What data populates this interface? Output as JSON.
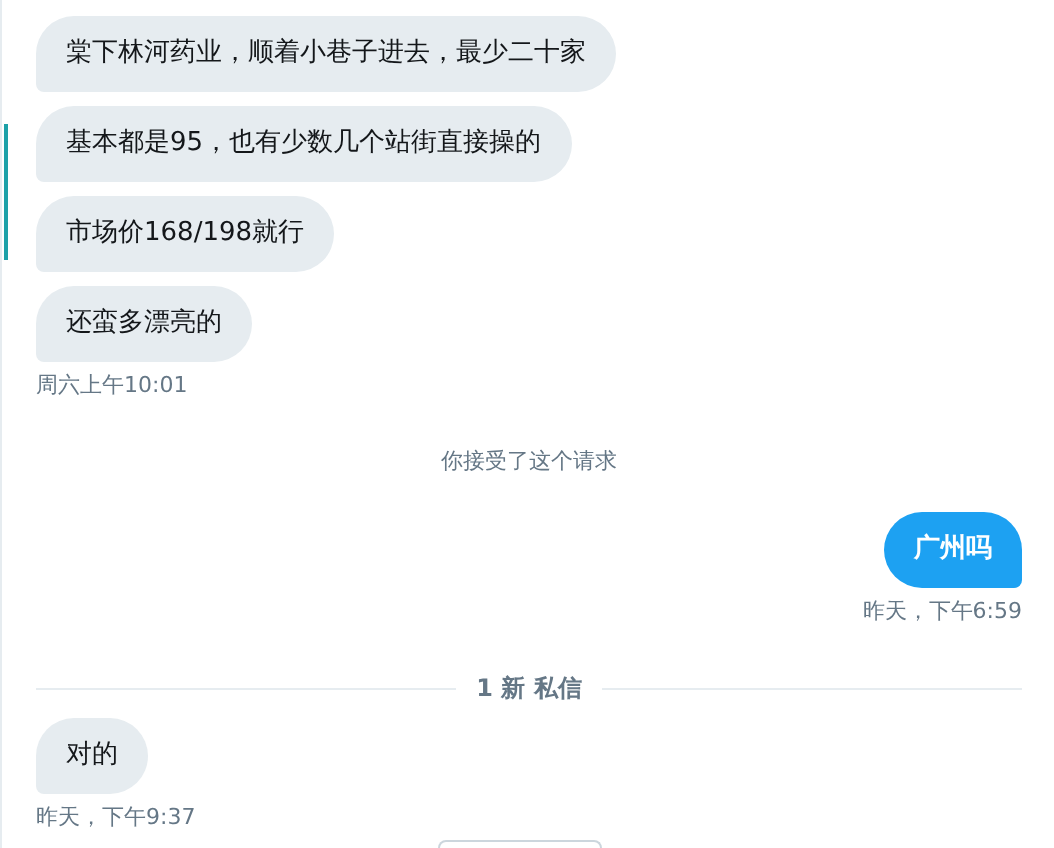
{
  "messages": [
    {
      "kind": "received",
      "text": "棠下林河药业，顺着小巷子进去，最少二十家"
    },
    {
      "kind": "received",
      "text": "基本都是95，也有少数几个站街直接操的"
    },
    {
      "kind": "received",
      "text": "市场价168/198就行"
    },
    {
      "kind": "received",
      "text": "还蛮多漂亮的"
    },
    {
      "kind": "received_time",
      "text": "周六上午10:01"
    },
    {
      "kind": "system",
      "text": "你接受了这个请求"
    },
    {
      "kind": "sent",
      "text": "广州吗"
    },
    {
      "kind": "sent_time",
      "text": "昨天，下午6:59"
    },
    {
      "kind": "divider",
      "text": "1 新 私信"
    },
    {
      "kind": "received",
      "text": "对的"
    },
    {
      "kind": "received_time",
      "text": "昨天，下午9:37"
    }
  ]
}
